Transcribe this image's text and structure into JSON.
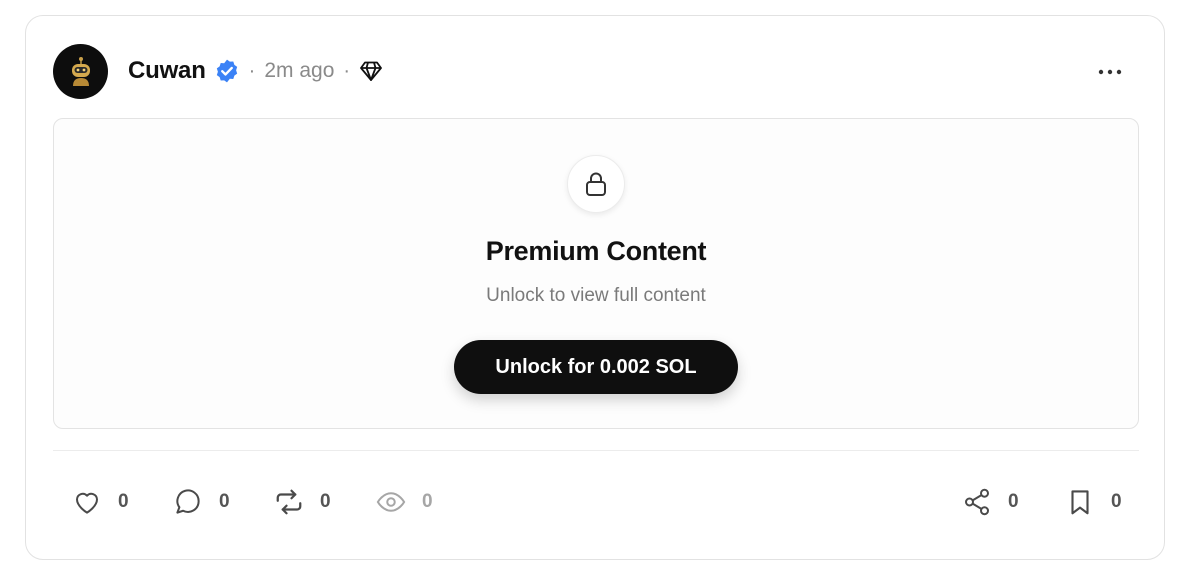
{
  "post": {
    "author_name": "Cuwan",
    "separator": "·",
    "timestamp": "2m ago",
    "badges": [
      "verified-icon",
      "diamond-icon"
    ],
    "more_icon": "more-horizontal-icon"
  },
  "premium": {
    "icon": "lock-icon",
    "title": "Premium Content",
    "subtitle": "Unlock to view full content",
    "unlock_label": "Unlock for 0.002 SOL"
  },
  "actions": {
    "like": {
      "icon": "heart-icon",
      "count": "0"
    },
    "comment": {
      "icon": "comment-icon",
      "count": "0"
    },
    "repost": {
      "icon": "repost-icon",
      "count": "0"
    },
    "views": {
      "icon": "eye-icon",
      "count": "0"
    },
    "share": {
      "icon": "share-icon",
      "count": "0"
    },
    "bookmark": {
      "icon": "bookmark-icon",
      "count": "0"
    }
  },
  "colors": {
    "verified": "#3b82f6",
    "button": "#0f0f0f",
    "muted_text": "#8a8a8a",
    "border": "#e2e2e2"
  }
}
